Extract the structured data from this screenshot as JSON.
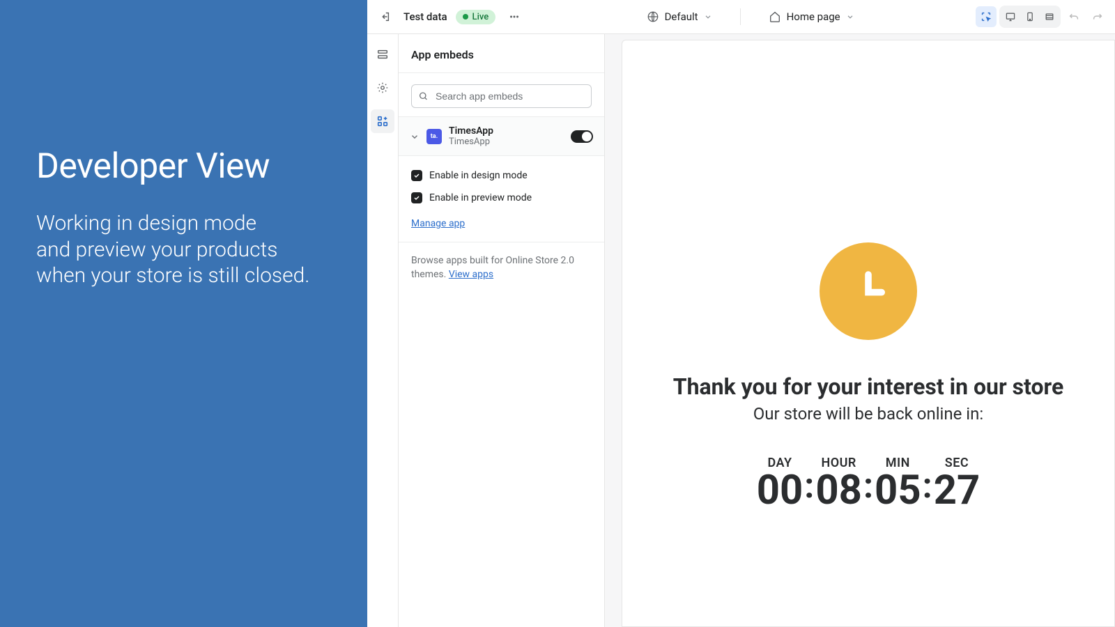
{
  "promo": {
    "title": "Developer View",
    "line1": "Working in design mode",
    "line2": "and preview your products",
    "line3": "when your store is still closed."
  },
  "topbar": {
    "test_label": "Test data",
    "live_label": "Live",
    "default_label": "Default",
    "home_label": "Home page"
  },
  "panel": {
    "title": "App embeds",
    "search_placeholder": "Search app embeds",
    "app_title": "TimesApp",
    "app_subtitle": "TimesApp",
    "app_logo_text": "ta.",
    "chk_design": "Enable in design mode",
    "chk_preview": "Enable in preview mode",
    "manage_label": "Manage app",
    "browse_text": "Browse apps built for Online Store 2.0 themes. ",
    "view_apps": "View apps"
  },
  "preview": {
    "headline": "Thank you for your interest in our store",
    "subline": "Our store will be back online in:",
    "labels": {
      "day": "DAY",
      "hour": "HOUR",
      "min": "MIN",
      "sec": "SEC"
    },
    "values": {
      "day": "00",
      "hour": "08",
      "min": "05",
      "sec": "27"
    },
    "sep": ":"
  }
}
